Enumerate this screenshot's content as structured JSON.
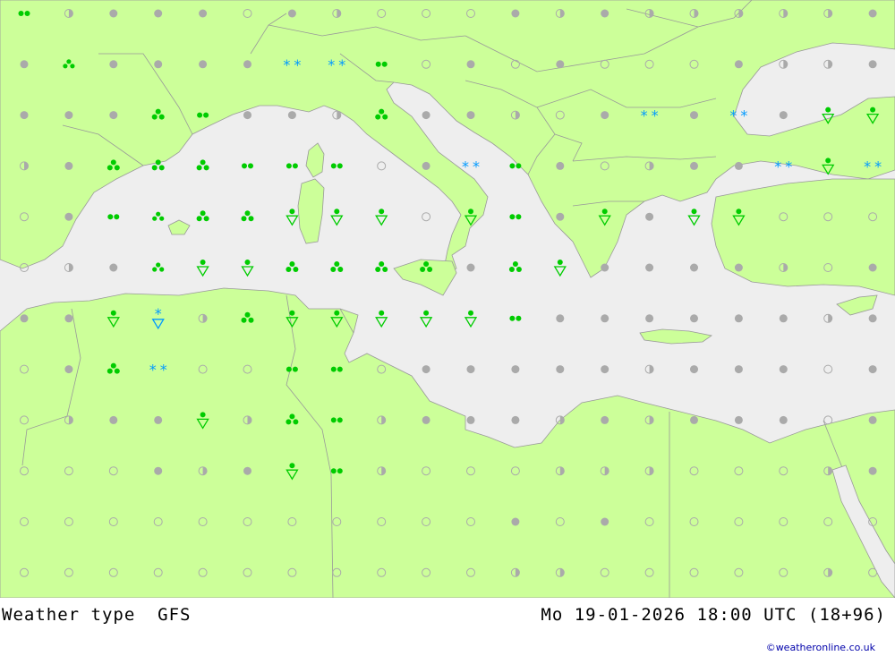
{
  "footer": {
    "label": "Weather type",
    "model": "GFS",
    "datetime": "Mo 19-01-2026 18:00 UTC (18+96)",
    "credit": "©weatheronline.co.uk"
  },
  "colors": {
    "land": "#ccff99",
    "sea": "#eeeeee",
    "border": "#999999",
    "rain": "#00cc00",
    "snow": "#0099ff",
    "cloud": "#aaaaaa"
  },
  "legend_symbols": [
    "overcast",
    "partly-cloudy",
    "clear",
    "rain",
    "shower",
    "snow",
    "snow-shower",
    "heavy-rain"
  ],
  "grid": {
    "cols": 20,
    "rows": 12,
    "cells": [
      "RqOOOpOqpppOqOqqqqqO",
      "OsOOOOSSrpOpOpppOqqO",
      "OOOtrOOqtOOqpOSOSOnn",
      "qOtttrrrpOSrOpqOOSnS",
      "pOrsttnnnpnrOnOnnppp",
      "pqOsnnttttOtnOOOOqpO",
      "OOnuqtnnnnnrOOOOOOqO",
      "pOtSpprrpOOOOOqOOOpO",
      "pqOOnqtrqOOOqOqOOOpO",
      "pppOqOnrqpppqqqpppqO",
      "pppppppppppOpOpppppp",
      "pppppppppppqqpppppqp"
    ],
    "key": {
      "O": "overcast",
      "q": "partly-cloudy",
      "p": "clear",
      "r": "rain",
      "t": "heavy-rain",
      "s": "shower",
      "n": "rain-shower",
      "S": "snow",
      "u": "snow-shower",
      "R": "rain"
    }
  }
}
